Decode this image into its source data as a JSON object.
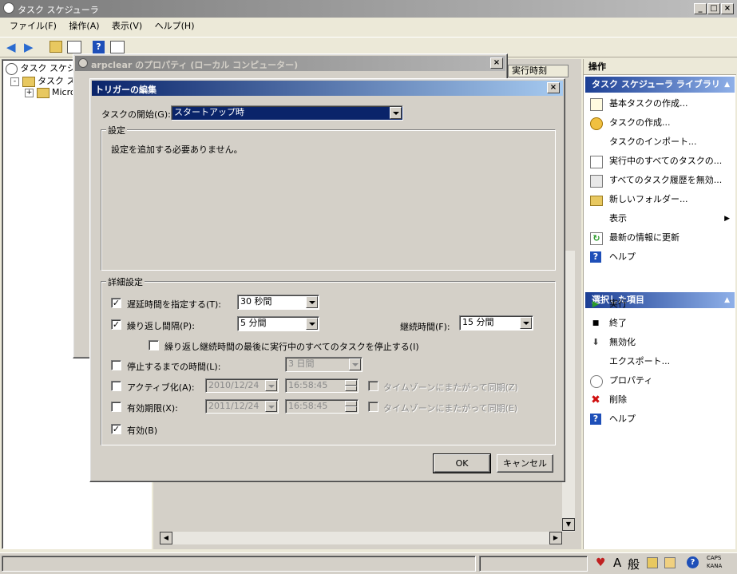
{
  "main_window": {
    "title": "タスク スケジューラ",
    "menu": [
      "ファイル(F)",
      "操作(A)",
      "表示(V)",
      "ヘルプ(H)"
    ]
  },
  "tree": {
    "items": [
      "タスク スケジューラ",
      "タスク スケ",
      "Micro"
    ]
  },
  "center": {
    "column_header": "実行時刻"
  },
  "actions_pane": {
    "header": "操作",
    "library_section": "タスク スケジューラ ライブラリ",
    "library_items": [
      {
        "label": "基本タスクの作成...",
        "icon": "basic-task-icon"
      },
      {
        "label": "タスクの作成...",
        "icon": "create-task-icon"
      },
      {
        "label": "タスクのインポート...",
        "icon": ""
      },
      {
        "label": "実行中のすべてのタスクの...",
        "icon": "running-tasks-icon"
      },
      {
        "label": "すべてのタスク履歴を無効...",
        "icon": "history-icon"
      },
      {
        "label": "新しいフォルダー...",
        "icon": "folder-icon"
      },
      {
        "label": "表示",
        "icon": ""
      },
      {
        "label": "最新の情報に更新",
        "icon": "refresh-icon"
      },
      {
        "label": "ヘルプ",
        "icon": "help-icon"
      }
    ],
    "selected_section": "選択した項目",
    "selected_items": [
      {
        "label": "実行",
        "icon": "run-icon"
      },
      {
        "label": "終了",
        "icon": "stop-icon"
      },
      {
        "label": "無効化",
        "icon": "disable-icon"
      },
      {
        "label": "エクスポート...",
        "icon": ""
      },
      {
        "label": "プロパティ",
        "icon": "properties-icon"
      },
      {
        "label": "削除",
        "icon": "delete-icon"
      },
      {
        "label": "ヘルプ",
        "icon": "help-icon"
      }
    ]
  },
  "properties_dialog": {
    "title": "arpclear のプロパティ (ローカル コンピューター)"
  },
  "trigger_dialog": {
    "title": "トリガーの編集",
    "begin_label": "タスクの開始(G):",
    "begin_value": "スタートアップ時",
    "settings_group": "設定",
    "settings_message": "設定を追加する必要ありません。",
    "advanced_group": "詳細設定",
    "delay_label": "遅延時間を指定する(T):",
    "delay_checked": true,
    "delay_value": "30 秒間",
    "repeat_label": "繰り返し間隔(P):",
    "repeat_checked": true,
    "repeat_value": "5 分間",
    "duration_label": "継続時間(F):",
    "duration_value": "15 分間",
    "stop_all_label": "繰り返し継続時間の最後に実行中のすべてのタスクを停止する(I)",
    "stop_all_checked": false,
    "stop_after_label": "停止するまでの時間(L):",
    "stop_after_checked": false,
    "stop_after_value": "3 日間",
    "activate_label": "アクティブ化(A):",
    "activate_checked": false,
    "activate_date": "2010/12/24",
    "activate_time": "16:58:45",
    "activate_sync_label": "タイムゾーンにまたがって同期(Z)",
    "expire_label": "有効期限(X):",
    "expire_checked": false,
    "expire_date": "2011/12/24",
    "expire_time": "16:58:45",
    "expire_sync_label": "タイムゾーンにまたがって同期(E)",
    "enabled_label": "有効(B)",
    "enabled_checked": true,
    "ok_label": "OK",
    "cancel_label": "キャンセル"
  },
  "taskbar": {
    "ime_mode": "A",
    "ime_kana": "般",
    "caps": "CAPS",
    "kana": "KANA"
  },
  "colors": {
    "active_title": "#0a246a",
    "section_header": "#1c3f94",
    "face": "#d4d0c8"
  }
}
